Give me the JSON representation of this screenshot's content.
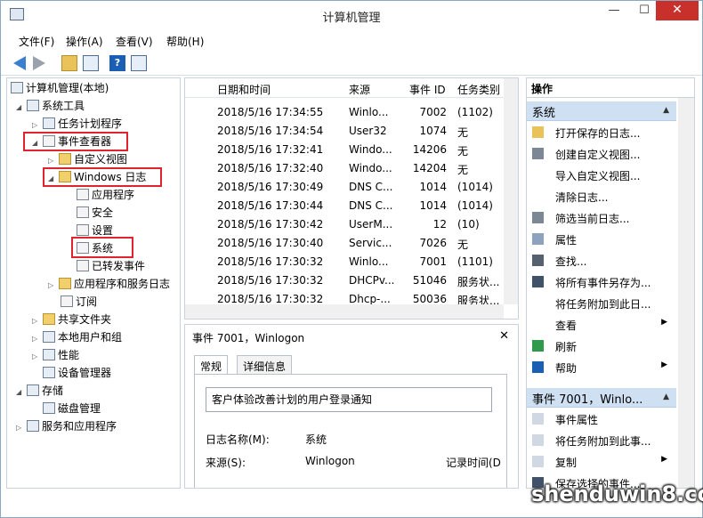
{
  "window": {
    "title": "计算机管理",
    "minimize": "—",
    "maximize": "☐",
    "close": "✕"
  },
  "menu": [
    "文件(F)",
    "操作(A)",
    "查看(V)",
    "帮助(H)"
  ],
  "tree": {
    "root": "计算机管理(本地)",
    "system_tools": "系统工具",
    "task_scheduler": "任务计划程序",
    "event_viewer": "事件查看器",
    "custom_views": "自定义视图",
    "windows_logs": "Windows 日志",
    "application": "应用程序",
    "security": "安全",
    "setup": "设置",
    "system": "系统",
    "forwarded": "已转发事件",
    "app_service_logs": "应用程序和服务日志",
    "subscriptions": "订阅",
    "shared_folders": "共享文件夹",
    "local_users": "本地用户和组",
    "performance": "性能",
    "device_manager": "设备管理器",
    "storage": "存储",
    "disk_management": "磁盘管理",
    "services_apps": "服务和应用程序"
  },
  "list": {
    "columns": [
      "日期和时间",
      "来源",
      "事件 ID",
      "任务类别"
    ],
    "rows": [
      [
        "2018/5/16 17:34:55",
        "Winlo...",
        "7002",
        "(1102)"
      ],
      [
        "2018/5/16 17:34:54",
        "User32",
        "1074",
        "无"
      ],
      [
        "2018/5/16 17:32:41",
        "Windo...",
        "14206",
        "无"
      ],
      [
        "2018/5/16 17:32:40",
        "Windo...",
        "14204",
        "无"
      ],
      [
        "2018/5/16 17:30:49",
        "DNS C...",
        "1014",
        "(1014)"
      ],
      [
        "2018/5/16 17:30:44",
        "DNS C...",
        "1014",
        "(1014)"
      ],
      [
        "2018/5/16 17:30:42",
        "UserM...",
        "12",
        "(10)"
      ],
      [
        "2018/5/16 17:30:40",
        "Servic...",
        "7026",
        "无"
      ],
      [
        "2018/5/16 17:30:32",
        "Winlo...",
        "7001",
        "(1101)"
      ],
      [
        "2018/5/16 17:30:32",
        "DHCPv...",
        "51046",
        "服务状..."
      ],
      [
        "2018/5/16 17:30:32",
        "Dhcp-...",
        "50036",
        "服务状..."
      ]
    ]
  },
  "detail": {
    "header": "事件 7001，Winlogon",
    "close": "✕",
    "tab_general": "常规",
    "tab_details": "详细信息",
    "description": "客户体验改善计划的用户登录通知",
    "log_name_label": "日志名称(M):",
    "log_name_value": "系统",
    "source_label": "来源(S):",
    "source_value": "Winlogon",
    "logged_label": "记录时间(D"
  },
  "actions": {
    "title": "操作",
    "section_system": "系统",
    "system_items": [
      "打开保存的日志...",
      "创建自定义视图...",
      "导入自定义视图...",
      "清除日志...",
      "筛选当前日志...",
      "属性",
      "查找...",
      "将所有事件另存为...",
      "将任务附加到此日...",
      "查看",
      "刷新",
      "帮助"
    ],
    "section_event": "事件 7001，Winlo...",
    "event_items": [
      "事件属性",
      "将任务附加到此事...",
      "复制",
      "保存选择的事件..."
    ]
  },
  "watermark": "shenduwin8.com"
}
